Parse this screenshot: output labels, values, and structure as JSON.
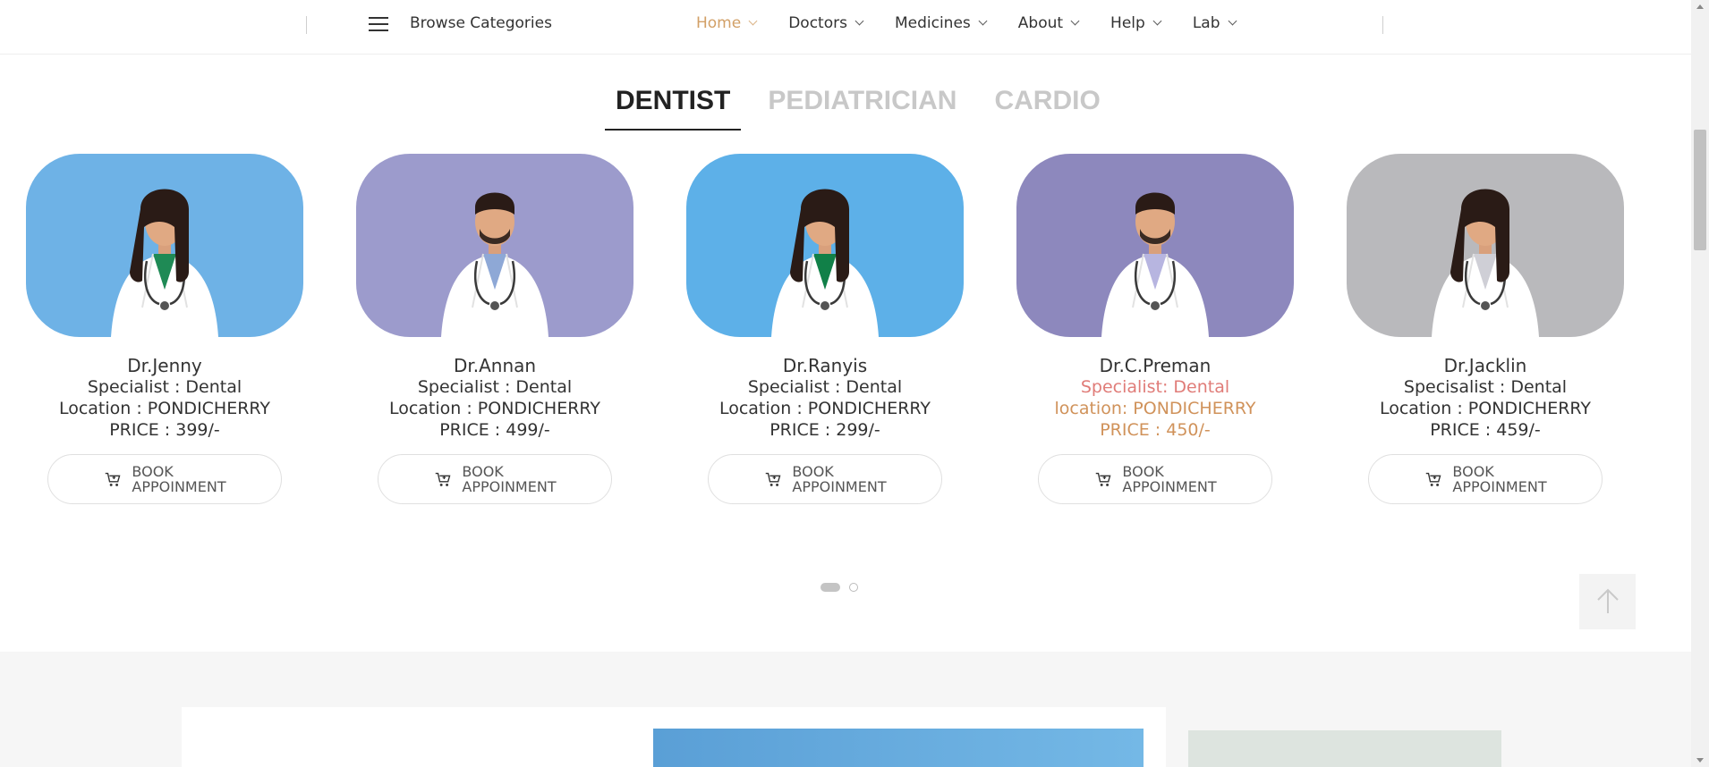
{
  "nav": {
    "browse_label": "Browse Categories",
    "items": [
      {
        "label": "Home",
        "active": true
      },
      {
        "label": "Doctors",
        "active": false
      },
      {
        "label": "Medicines",
        "active": false
      },
      {
        "label": "About",
        "active": false
      },
      {
        "label": "Help",
        "active": false
      },
      {
        "label": "Lab",
        "active": false
      }
    ],
    "active_color": "#d2a067"
  },
  "tabs": [
    {
      "label": "DENTIST",
      "active": true
    },
    {
      "label": "PEDIATRICIAN",
      "active": false
    },
    {
      "label": "CARDIO",
      "active": false
    }
  ],
  "doctors": [
    {
      "name": "Dr.Jenny",
      "specialty": "Specialist : Dental",
      "location": "Location : PONDICHERRY",
      "price": "PRICE : 399/-",
      "book_line1": "BOOK",
      "book_line2": "APPOINMENT",
      "bg": "#6eb2e6",
      "coat": "#ffffff",
      "shirt": "#1f8a55"
    },
    {
      "name": "Dr.Annan",
      "specialty": "Specialist : Dental",
      "location": "Location : PONDICHERRY",
      "price": "PRICE : 499/-",
      "book_line1": "BOOK",
      "book_line2": "APPOINMENT",
      "bg": "#9c9bcc",
      "coat": "#ffffff",
      "shirt": "#8ea8d6"
    },
    {
      "name": "Dr.Ranyis",
      "specialty": "Specialist : Dental",
      "location": "Location : PONDICHERRY",
      "price": "PRICE : 299/-",
      "book_line1": "BOOK",
      "book_line2": "APPOINMENT",
      "bg": "#5db0e8",
      "coat": "#ffffff",
      "shirt": "#118048"
    },
    {
      "name": "Dr.C.Preman",
      "specialty": "Specialist: Dental",
      "location": "location: PONDICHERRY",
      "price": "PRICE : 450/-",
      "book_line1": "BOOK",
      "book_line2": "APPOINMENT",
      "bg": "#8d88bd",
      "coat": "#ffffff",
      "shirt": "#b7b5e0",
      "highlight": true
    },
    {
      "name": "Dr.Jacklin",
      "specialty": "Specisalist : Dental",
      "location": "Location : PONDICHERRY",
      "price": "PRICE : 459/-",
      "book_line1": "BOOK",
      "book_line2": "APPOINMENT",
      "bg": "#b9b9bc",
      "coat": "#ffffff",
      "shirt": "#cfcfd6"
    }
  ],
  "pagination": {
    "current": 1,
    "total": 2
  },
  "colors": {
    "highlight_specialty": "#e07c78",
    "highlight_price": "#d0925a"
  }
}
